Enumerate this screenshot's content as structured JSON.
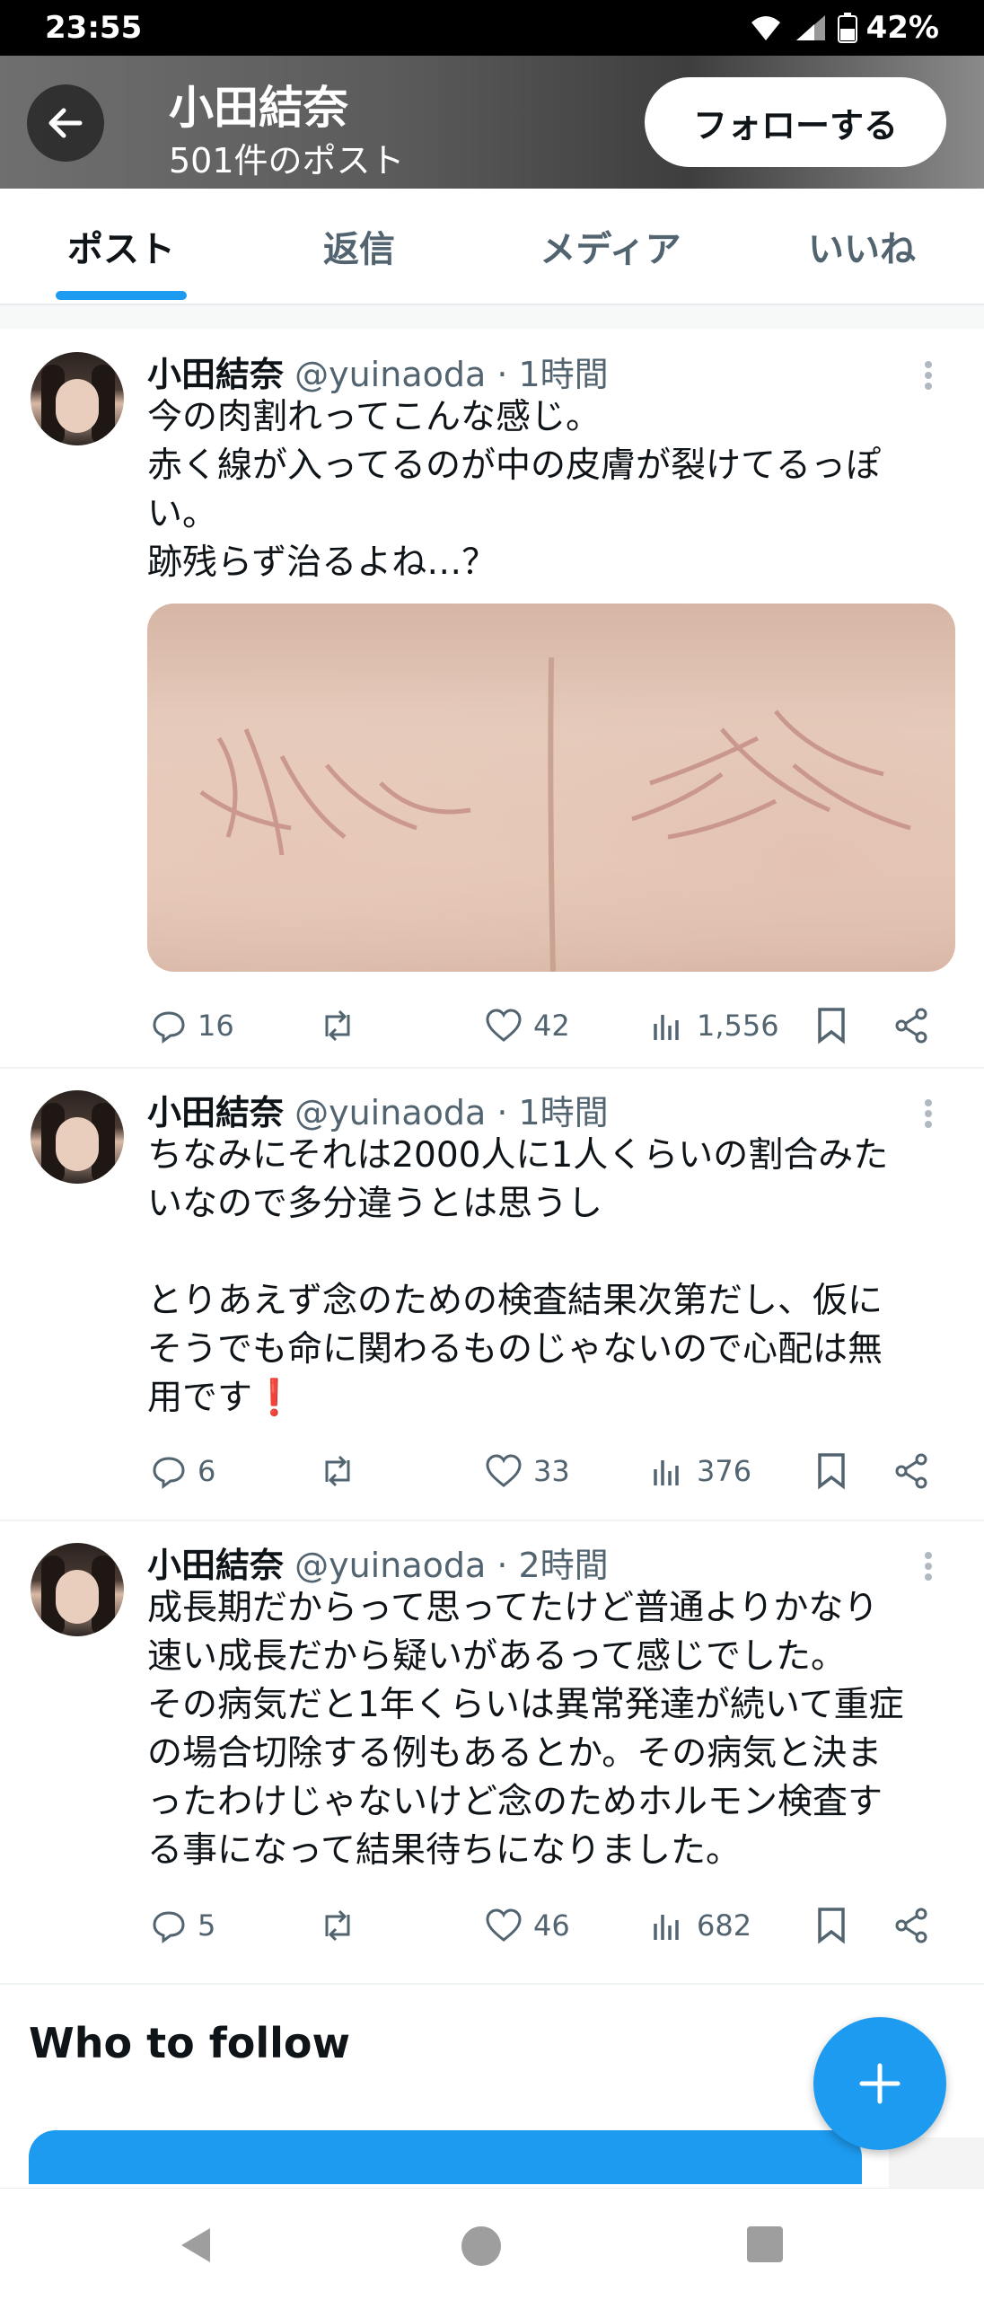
{
  "status_bar": {
    "time": "23:55",
    "battery": "42%"
  },
  "header": {
    "name": "小田結奈",
    "post_count": "501件のポスト",
    "follow_label": "フォローする"
  },
  "tabs": [
    {
      "label": "ポスト",
      "active": true
    },
    {
      "label": "返信",
      "active": false
    },
    {
      "label": "メディア",
      "active": false
    },
    {
      "label": "いいね",
      "active": false
    }
  ],
  "tweets": [
    {
      "name": "小田結奈",
      "handle": "@yuinaoda · 1時間",
      "text_lines": [
        "今の肉割れってこんな感じ。",
        "赤く線が入ってるのが中の皮膚が裂けてるっぽ",
        "い。",
        "跡残らず治るよね…？"
      ],
      "replies": "16",
      "likes": "42",
      "views": "1,556"
    },
    {
      "name": "小田結奈",
      "handle": "@yuinaoda · 1時間",
      "text_lines": [
        "ちなみにそれは2000人に1人くらいの割合みた",
        "いなので多分違うとは思うし",
        "",
        "とりあえず念のための検査結果次第だし、仮に",
        "そうでも命に関わるものじゃないので心配は無",
        "用です❗"
      ],
      "replies": "6",
      "likes": "33",
      "views": "376"
    },
    {
      "name": "小田結奈",
      "handle": "@yuinaoda · 2時間",
      "text_lines": [
        "成長期だからって思ってたけど普通よりかなり",
        "速い成長だから疑いがあるって感じでした。",
        "その病気だと1年くらいは異常発達が続いて重症",
        "の場合切除する例もあるとか。その病気と決ま",
        "ったわけじゃないけど念のためホルモン検査す",
        "る事になって結果待ちになりました。"
      ],
      "replies": "5",
      "likes": "46",
      "views": "682"
    }
  ],
  "who_to_follow": {
    "title": "Who to follow"
  },
  "colors": {
    "accent": "#1d9bf0",
    "text": "#0f1419",
    "muted": "#536471"
  }
}
